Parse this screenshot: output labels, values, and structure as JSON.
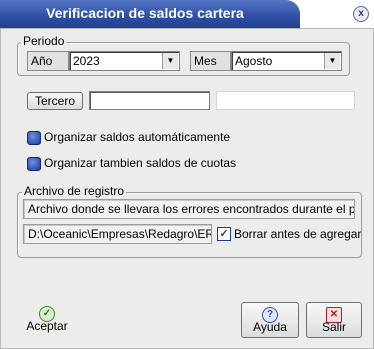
{
  "window": {
    "title": "Verificacion de saldos cartera",
    "close_label": "x"
  },
  "periodo": {
    "legend": "Periodo",
    "ano_label": "Año",
    "ano_value": "2023",
    "mes_label": "Mes",
    "mes_value": "Agosto"
  },
  "tercero": {
    "button_label": "Tercero",
    "value": "",
    "description": ""
  },
  "options": {
    "organizar_saldos": "Organizar saldos automáticamente",
    "organizar_cuotas": "Organizar tambien saldos de cuotas"
  },
  "archivo": {
    "legend": "Archivo de registro",
    "description": "Archivo donde se llevara los errores encontrados durante el proceso",
    "path": "D:\\Oceanic\\Empresas\\Redagro\\ERR",
    "borrar_label": "Borrar antes de agregar",
    "borrar_checked": true
  },
  "buttons": {
    "aceptar": "Aceptar",
    "ayuda": "Ayuda",
    "salir": "Salir"
  },
  "colors": {
    "title_bar": "#3050a8",
    "accent_blue": "#1c3c9e",
    "window_bg": "#ececea"
  }
}
